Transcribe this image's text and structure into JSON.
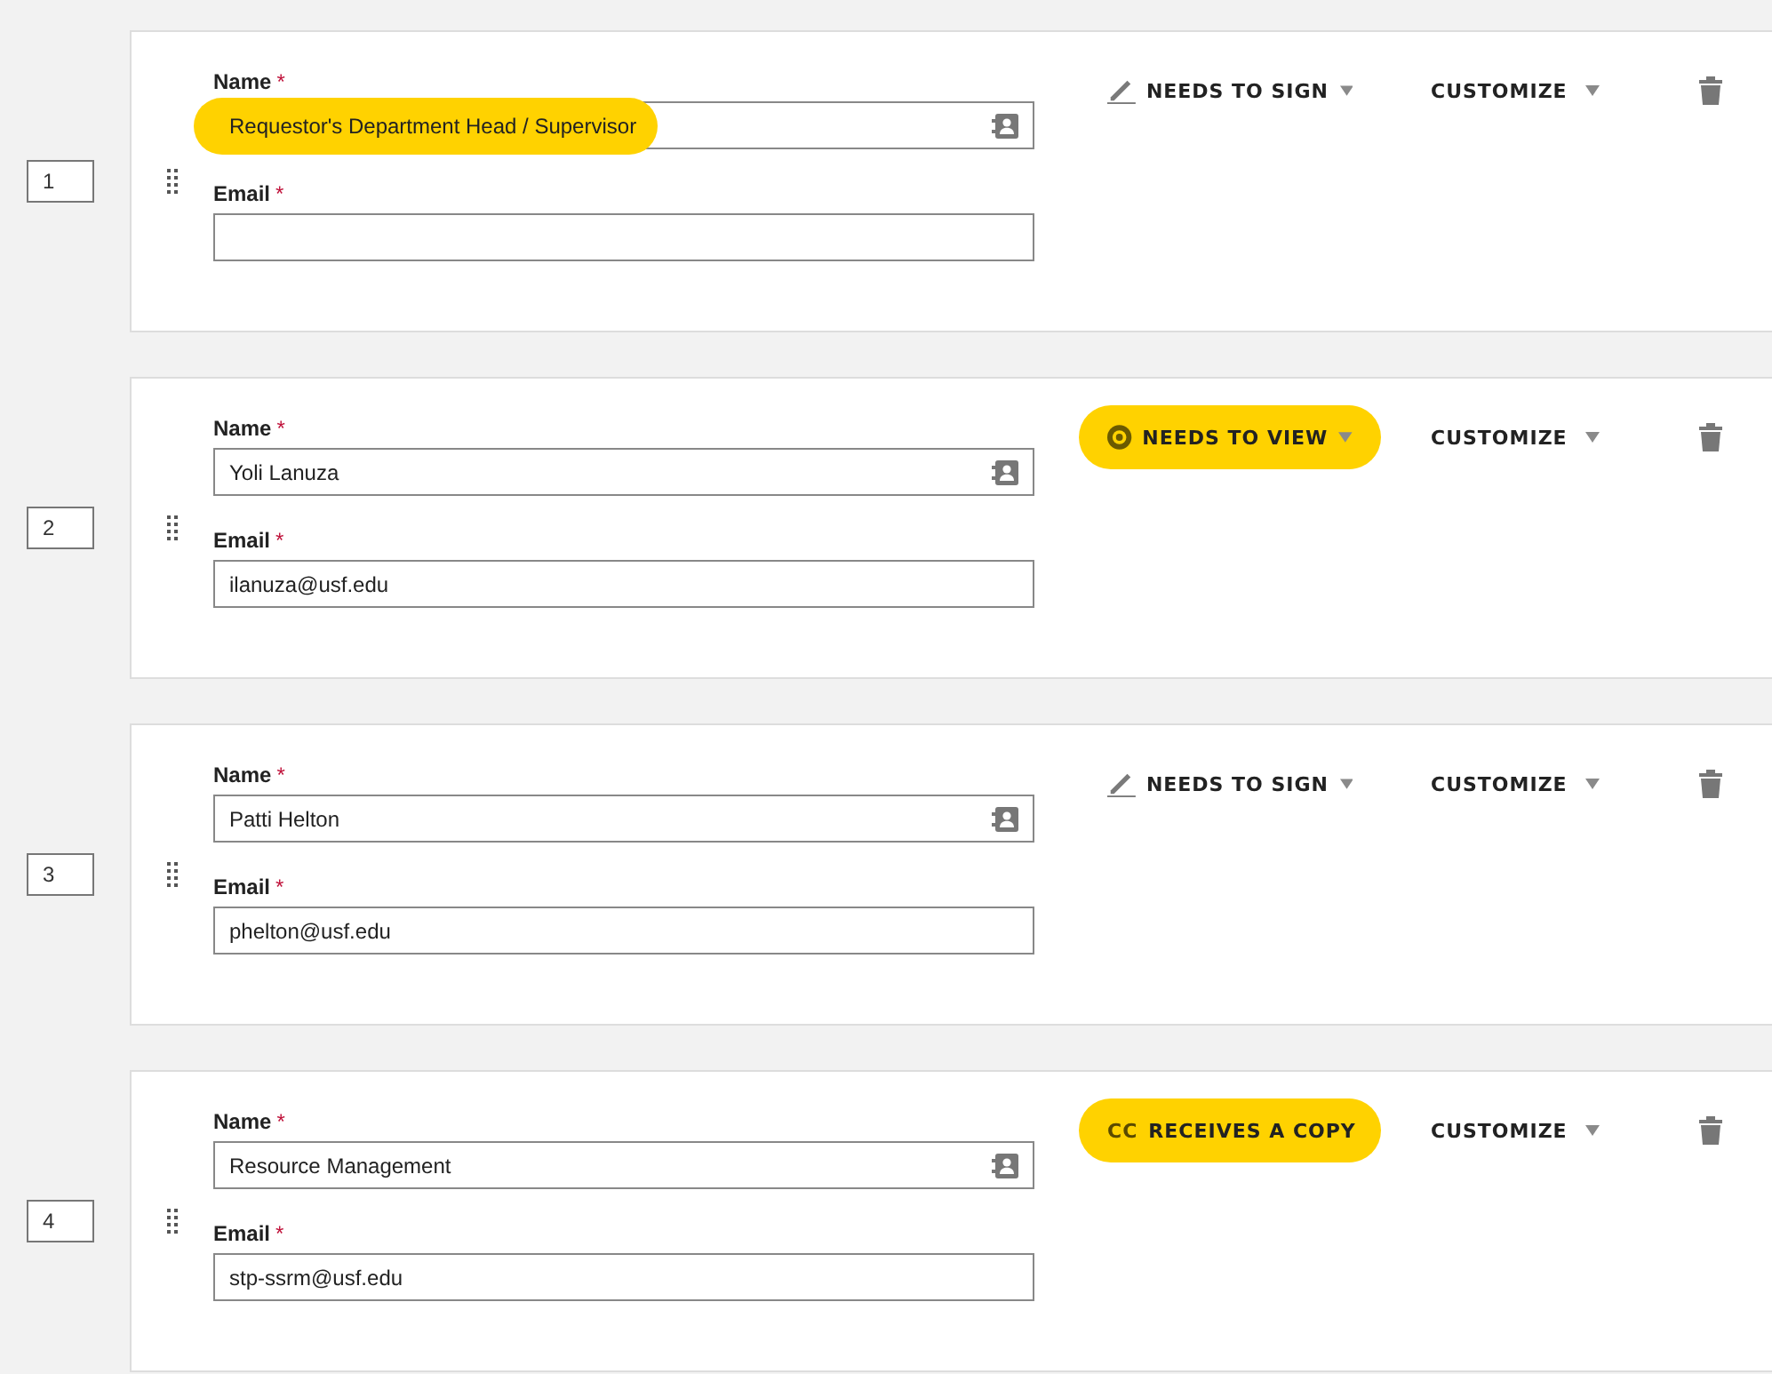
{
  "recipients": [
    {
      "order": "1",
      "name_label": "Name",
      "email_label": "Email",
      "required_mark": "*",
      "name": "Requestor's Department Head / Supervisor",
      "name_highlighted": true,
      "action": {
        "kind": "sign",
        "label": "NEEDS TO SIGN",
        "highlighted": false
      },
      "customize": "CUSTOMIZE"
    },
    {
      "order": "2",
      "name_label": "Name",
      "email_label": "Email",
      "required_mark": "*",
      "name": "Yoli Lanuza",
      "name_highlighted": false,
      "email": "ilanuza@usf.edu",
      "action": {
        "kind": "view",
        "label": "NEEDS TO VIEW",
        "highlighted": true
      },
      "customize": "CUSTOMIZE"
    },
    {
      "order": "3",
      "name_label": "Name",
      "email_label": "Email",
      "required_mark": "*",
      "name": "Patti Helton",
      "name_highlighted": false,
      "email": "phelton@usf.edu",
      "action": {
        "kind": "sign",
        "label": "NEEDS TO SIGN",
        "highlighted": false
      },
      "customize": "CUSTOMIZE"
    },
    {
      "order": "4",
      "name_label": "Name",
      "email_label": "Email",
      "required_mark": "*",
      "name": "Resource Management",
      "name_highlighted": false,
      "email": "stp-ssrm@usf.edu",
      "action": {
        "kind": "copy",
        "badge": "CC",
        "label": "RECEIVES A COPY",
        "highlighted": true
      },
      "customize": "CUSTOMIZE"
    }
  ]
}
